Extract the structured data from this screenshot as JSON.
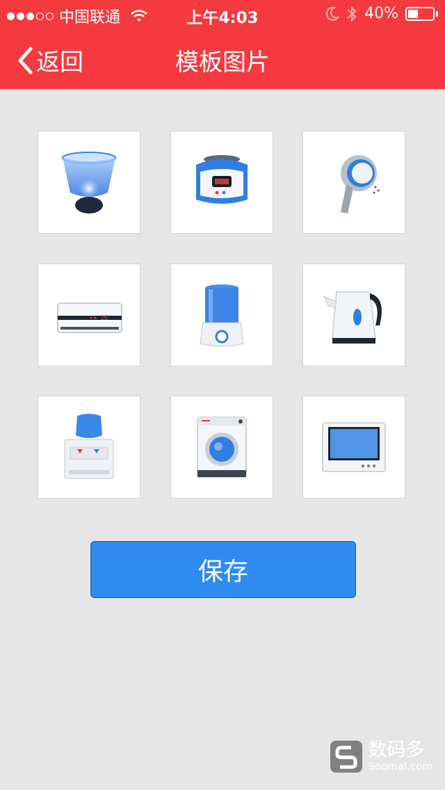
{
  "status_bar": {
    "signal_dots_filled": 3,
    "signal_dots_total": 5,
    "carrier": "中国联通",
    "time": "上午4:03",
    "battery_text": "40%",
    "battery_level": 0.4
  },
  "nav": {
    "back_label": "返回",
    "title": "模板图片"
  },
  "templates": [
    {
      "name": "table-lamp",
      "icon": "lamp-icon"
    },
    {
      "name": "rice-cooker",
      "icon": "rice-cooker-icon"
    },
    {
      "name": "shower-head",
      "icon": "shower-icon"
    },
    {
      "name": "air-conditioner",
      "icon": "air-conditioner-icon",
      "display": "25"
    },
    {
      "name": "humidifier",
      "icon": "humidifier-icon"
    },
    {
      "name": "electric-kettle",
      "icon": "kettle-icon"
    },
    {
      "name": "water-dispenser",
      "icon": "water-dispenser-icon"
    },
    {
      "name": "washing-machine",
      "icon": "washing-machine-icon"
    },
    {
      "name": "television",
      "icon": "tv-icon"
    }
  ],
  "save_label": "保存",
  "watermark": {
    "cn": "数码多",
    "en": "Soomal.com"
  },
  "colors": {
    "header": "#f43a3e",
    "background": "#e6e6e6",
    "button": "#2e8bef",
    "appliance_blue": "#2f7fe0"
  }
}
